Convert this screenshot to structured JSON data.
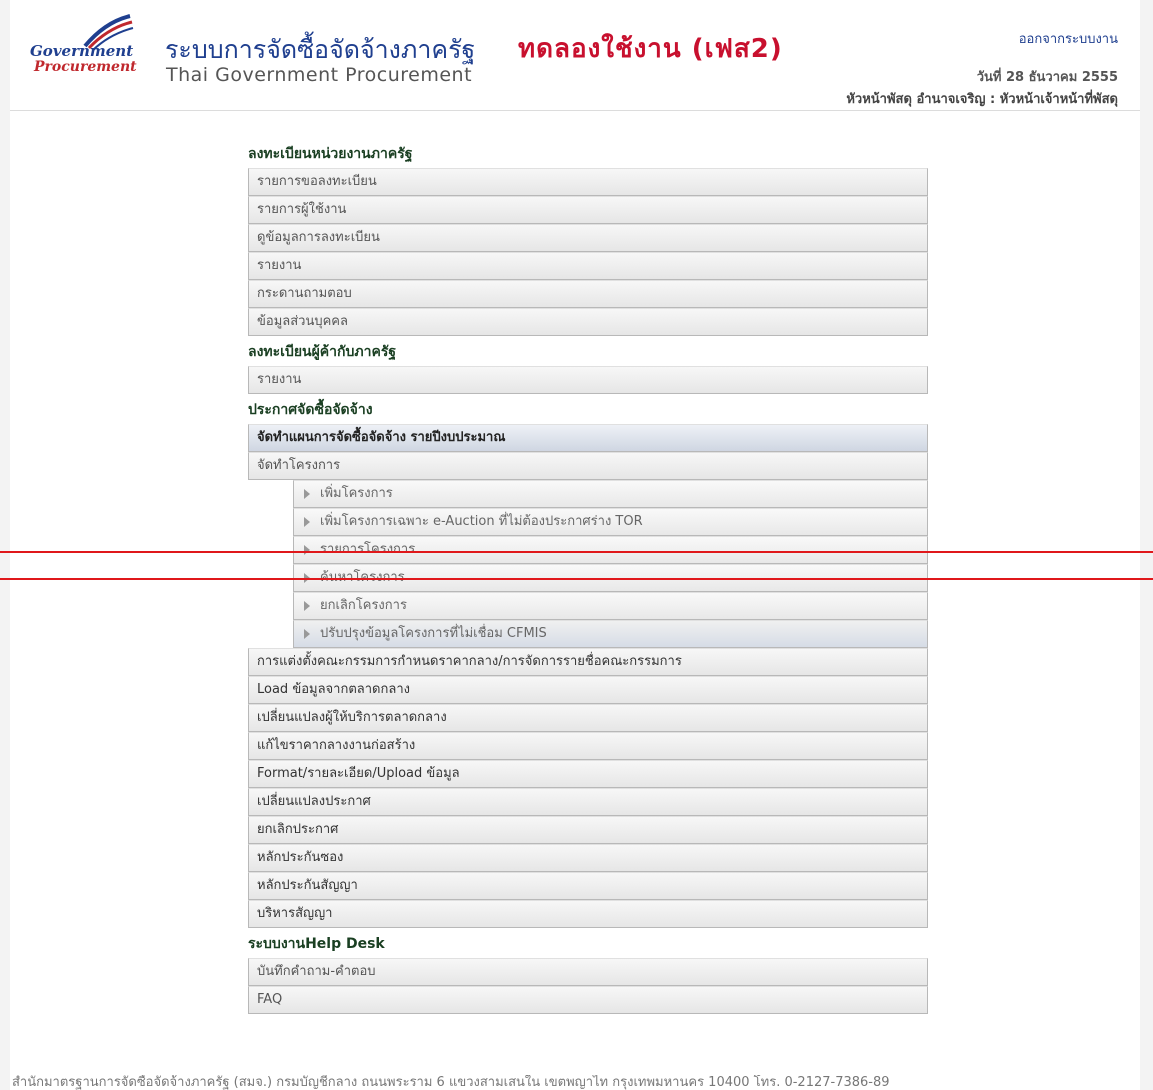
{
  "header": {
    "logo_line1": "Government",
    "logo_line2": "Procurement",
    "title_th": "ระบบการจัดซื้อจัดจ้างภาครัฐ",
    "title_test": "ทดลองใช้งาน (เฟส2)",
    "title_en": "Thai Government Procurement",
    "logout": "ออกจากระบบงาน",
    "date": "วันที่ 28 ธันวาคม 2555",
    "user": "หัวหน้าพัสดุ อำนาจเจริญ : หัวหน้าเจ้าหน้าที่พัสดุ"
  },
  "menu": {
    "sections": [
      {
        "title": "ลงทะเบียนหน่วยงานภาครัฐ",
        "items": [
          "รายการขอลงทะเบียน",
          "รายการผู้ใช้งาน",
          "ดูข้อมูลการลงทะเบียน",
          "รายงาน",
          "กระดานถามตอบ",
          "ข้อมูลส่วนบุคคล"
        ]
      },
      {
        "title": "ลงทะเบียนผู้ค้ากับภาครัฐ",
        "items": [
          "รายงาน"
        ]
      },
      {
        "title": "ประกาศจัดซื้อจัดจ้าง",
        "items": [
          "จัดทำแผนการจัดซื้อจัดจ้าง รายปีงบประมาณ",
          "จัดทำโครงการ"
        ],
        "sub_items": [
          "เพิ่มโครงการ",
          "เพิ่มโครงการเฉพาะ e-Auction ที่ไม่ต้องประกาศร่าง TOR",
          "รายการโครงการ",
          "ค้นหาโครงการ",
          "ยกเลิกโครงการ",
          "ปรับปรุงข้อมูลโครงการที่ไม่เชื่อม CFMIS"
        ],
        "items_after": [
          "การแต่งตั้งคณะกรรมการกำหนดราคากลาง/การจัดการรายชื่อคณะกรรมการ",
          "Load ข้อมูลจากตลาดกลาง",
          "เปลี่ยนแปลงผู้ให้บริการตลาดกลาง",
          "แก้ไขราคากลางงานก่อสร้าง",
          "Format/รายละเอียด/Upload ข้อมูล",
          "เปลี่ยนแปลงประกาศ",
          "ยกเลิกประกาศ",
          "หลักประกันซอง",
          "หลักประกันสัญญา",
          "บริหารสัญญา"
        ]
      },
      {
        "title": "ระบบงานHelp Desk",
        "items": [
          "บันทึกคำถาม-คำตอบ",
          "FAQ"
        ]
      }
    ]
  },
  "footer": {
    "text": "สำนักมาตรฐานการจัดซื้อจัดจ้างภาครัฐ (สมจ.) กรมบัญชีกลาง ถนนพระราม 6 แขวงสามเสนใน เขตพญาไท กรุงเทพมหานคร 10400 โทร. 0-2127-7386-89"
  },
  "colors": {
    "accent": "#1f3f8f",
    "test_label": "#c8102e",
    "overlay_line": "#e0181b"
  }
}
